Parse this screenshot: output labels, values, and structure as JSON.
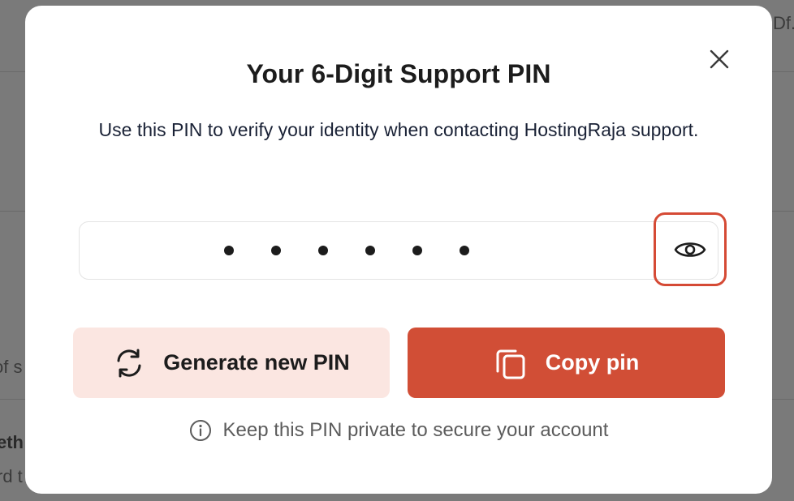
{
  "background": {
    "top_right_fragment": "Df...",
    "left_fragment_1": "of s",
    "left_fragment_2": "eth",
    "left_fragment_3": "rd t"
  },
  "modal": {
    "title": "Your 6-Digit Support PIN",
    "subtitle": "Use this PIN to verify your identity when contacting HostingRaja support.",
    "pin_masked_length": 6,
    "close_icon": "close-icon",
    "toggle_visibility_icon": "eye-icon",
    "generate_button": {
      "label": "Generate new PIN",
      "icon": "refresh-icon"
    },
    "copy_button": {
      "label": "Copy pin",
      "icon": "copy-icon"
    },
    "note": {
      "icon": "info-icon",
      "text": "Keep this PIN private to secure your account"
    }
  },
  "colors": {
    "accent": "#d14e36",
    "accent_light": "#fbe6e1",
    "highlight_border": "#d54a35",
    "overlay": "#7a7a7a"
  }
}
